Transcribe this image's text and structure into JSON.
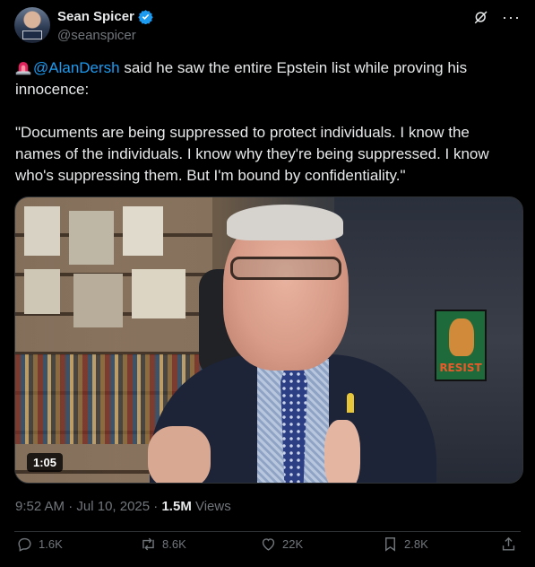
{
  "author": {
    "name": "Sean Spicer",
    "handle": "@seanspicer",
    "verified": true,
    "verified_color": "#1d9bf0"
  },
  "tweet": {
    "siren_icon": "rotating-light-emoji",
    "mention": "@AlanDersh",
    "line1_rest": " said he saw the entire Epstein list while proving his innocence:",
    "quote": "\"Documents are being suppressed to protect individuals. I know the names of the individuals. I know why they're being suppressed. I know who's suppressing them. But I'm bound by confidentiality.\""
  },
  "media": {
    "duration": "1:05",
    "poster_text": "RESIST"
  },
  "meta": {
    "time": "9:52 AM",
    "separator1": " · ",
    "date": "Jul 10, 2025",
    "separator2": " · ",
    "views_count": "1.5M",
    "views_label": " Views"
  },
  "actions": {
    "replies": "1.6K",
    "reposts": "8.6K",
    "likes": "22K",
    "bookmarks": "2.8K"
  },
  "colors": {
    "background": "#000000",
    "text": "#e7e9ea",
    "muted": "#71767b",
    "link": "#1d9bf0",
    "border": "#2f3336"
  }
}
